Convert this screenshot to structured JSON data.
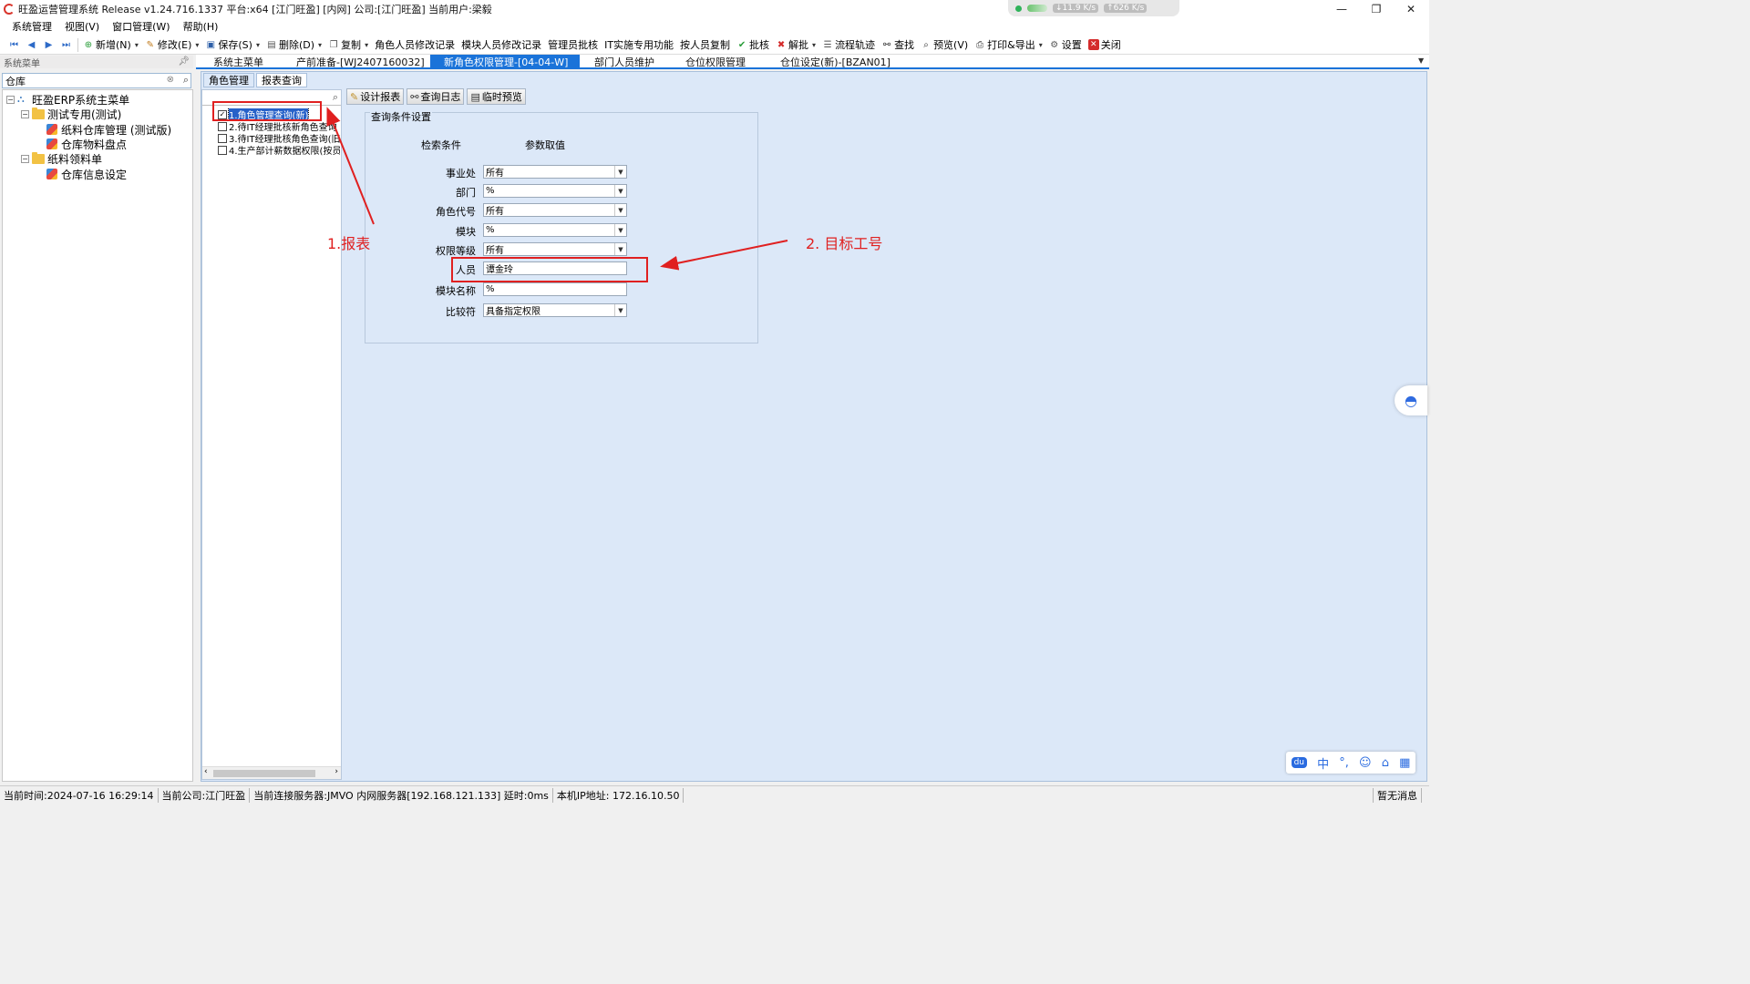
{
  "window": {
    "title": "旺盈运营管理系统 Release v1.24.716.1337 平台:x64  [江门旺盈] [内网] 公司:[江门旺盈] 当前用户:梁毅"
  },
  "net_widget": {
    "down": "11.9",
    "down_unit": "K/s",
    "up": "626",
    "up_unit": "K/s"
  },
  "menubar": [
    "系统管理",
    "视图(V)",
    "窗口管理(W)",
    "帮助(H)"
  ],
  "toolbar": [
    {
      "label": "新增(N)",
      "icon": "add-icon",
      "dropdown": true
    },
    {
      "label": "修改(E)",
      "icon": "edit-icon",
      "dropdown": true
    },
    {
      "label": "保存(S)",
      "icon": "save-icon",
      "dropdown": true
    },
    {
      "label": "删除(D)",
      "icon": "delete-icon",
      "dropdown": true
    },
    {
      "label": "复制",
      "icon": "copy-icon",
      "dropdown": true
    },
    {
      "label": "角色人员修改记录",
      "icon": "",
      "dropdown": false
    },
    {
      "label": "模块人员修改记录",
      "icon": "",
      "dropdown": false
    },
    {
      "label": "管理员批核",
      "icon": "",
      "dropdown": false
    },
    {
      "label": "IT实施专用功能",
      "icon": "",
      "dropdown": false
    },
    {
      "label": "按人员复制",
      "icon": "",
      "dropdown": false
    },
    {
      "label": "批核",
      "icon": "approve-icon",
      "dropdown": false
    },
    {
      "label": "解批",
      "icon": "unapprove-icon",
      "dropdown": true
    },
    {
      "label": "流程轨迹",
      "icon": "flow-icon",
      "dropdown": false
    },
    {
      "label": "查找",
      "icon": "binoculars-icon",
      "dropdown": false
    },
    {
      "label": "预览(V)",
      "icon": "preview-icon",
      "dropdown": false
    },
    {
      "label": "打印&导出",
      "icon": "print-icon",
      "dropdown": true
    },
    {
      "label": "设置",
      "icon": "gear-icon",
      "dropdown": false
    },
    {
      "label": "关闭",
      "icon": "close-icon",
      "dropdown": false
    }
  ],
  "left_panel": {
    "header": "系统菜单",
    "search_value": "仓库",
    "tree": [
      {
        "label": "旺盈ERP系统主菜单",
        "kind": "root"
      },
      {
        "label": "测试专用(测试)",
        "kind": "folder"
      },
      {
        "label": "纸料仓库管理 (测试版)",
        "kind": "leaf"
      },
      {
        "label": "仓库物料盘点",
        "kind": "leaf"
      },
      {
        "label": "纸料领料单",
        "kind": "folder"
      },
      {
        "label": "仓库信息设定",
        "kind": "leaf"
      }
    ]
  },
  "doc_tabs": [
    {
      "label": "系统主菜单",
      "active": false
    },
    {
      "label": "产前准备-[WJ2407160032]",
      "active": false
    },
    {
      "label": "新角色权限管理-[04-04-W]",
      "active": true
    },
    {
      "label": "部门人员维护",
      "active": false
    },
    {
      "label": "仓位权限管理",
      "active": false
    },
    {
      "label": "仓位设定(新)-[BZAN01]",
      "active": false
    }
  ],
  "inner_tabs": [
    {
      "label": "角色管理",
      "active": false
    },
    {
      "label": "报表查询",
      "active": true
    }
  ],
  "report_list": [
    {
      "label": "1.角色管理查询(新)",
      "checked": true,
      "selected": true
    },
    {
      "label": "2.待IT经理批核新角色查询",
      "checked": false,
      "selected": false
    },
    {
      "label": "3.待IT经理批核角色查询(旧)",
      "checked": false,
      "selected": false
    },
    {
      "label": "4.生产部计薪数据权限(按员",
      "checked": false,
      "selected": false
    }
  ],
  "report_buttons": [
    {
      "label": "设计报表",
      "icon": "design-icon"
    },
    {
      "label": "查询日志",
      "icon": "log-icon"
    },
    {
      "label": "临时预览",
      "icon": "preview-icon"
    }
  ],
  "query": {
    "legend": "查询条件设置",
    "col_condition": "检索条件",
    "col_value": "参数取值",
    "rows": [
      {
        "label": "事业处",
        "value": "所有",
        "dropdown": true
      },
      {
        "label": "部门",
        "value": "%",
        "dropdown": true
      },
      {
        "label": "角色代号",
        "value": "所有",
        "dropdown": true
      },
      {
        "label": "模块",
        "value": "%",
        "dropdown": true
      },
      {
        "label": "权限等级",
        "value": "所有",
        "dropdown": true
      },
      {
        "label": "人员",
        "value": "谭金玲",
        "dropdown": false
      },
      {
        "label": "模块名称",
        "value": "%",
        "dropdown": false
      },
      {
        "label": "比较符",
        "value": "具备指定权限",
        "dropdown": true
      }
    ]
  },
  "annotations": {
    "report": "1.报表",
    "target": "2. 目标工号",
    "color": "#e02020"
  },
  "ime": [
    "中",
    "°,",
    "☺",
    "⌂",
    "▦"
  ],
  "statusbar": {
    "time": "当前时间:2024-07-16 16:29:14",
    "company": "当前公司:江门旺盈",
    "server": "当前连接服务器:JMVO 内网服务器[192.168.121.133] 延时:0ms",
    "ip": "本机IP地址: 172.16.10.50",
    "messages": "暂无消息"
  },
  "colors": {
    "accent": "#1a73d9",
    "panel_bg": "#dce8f8",
    "highlight": "#e02020"
  }
}
